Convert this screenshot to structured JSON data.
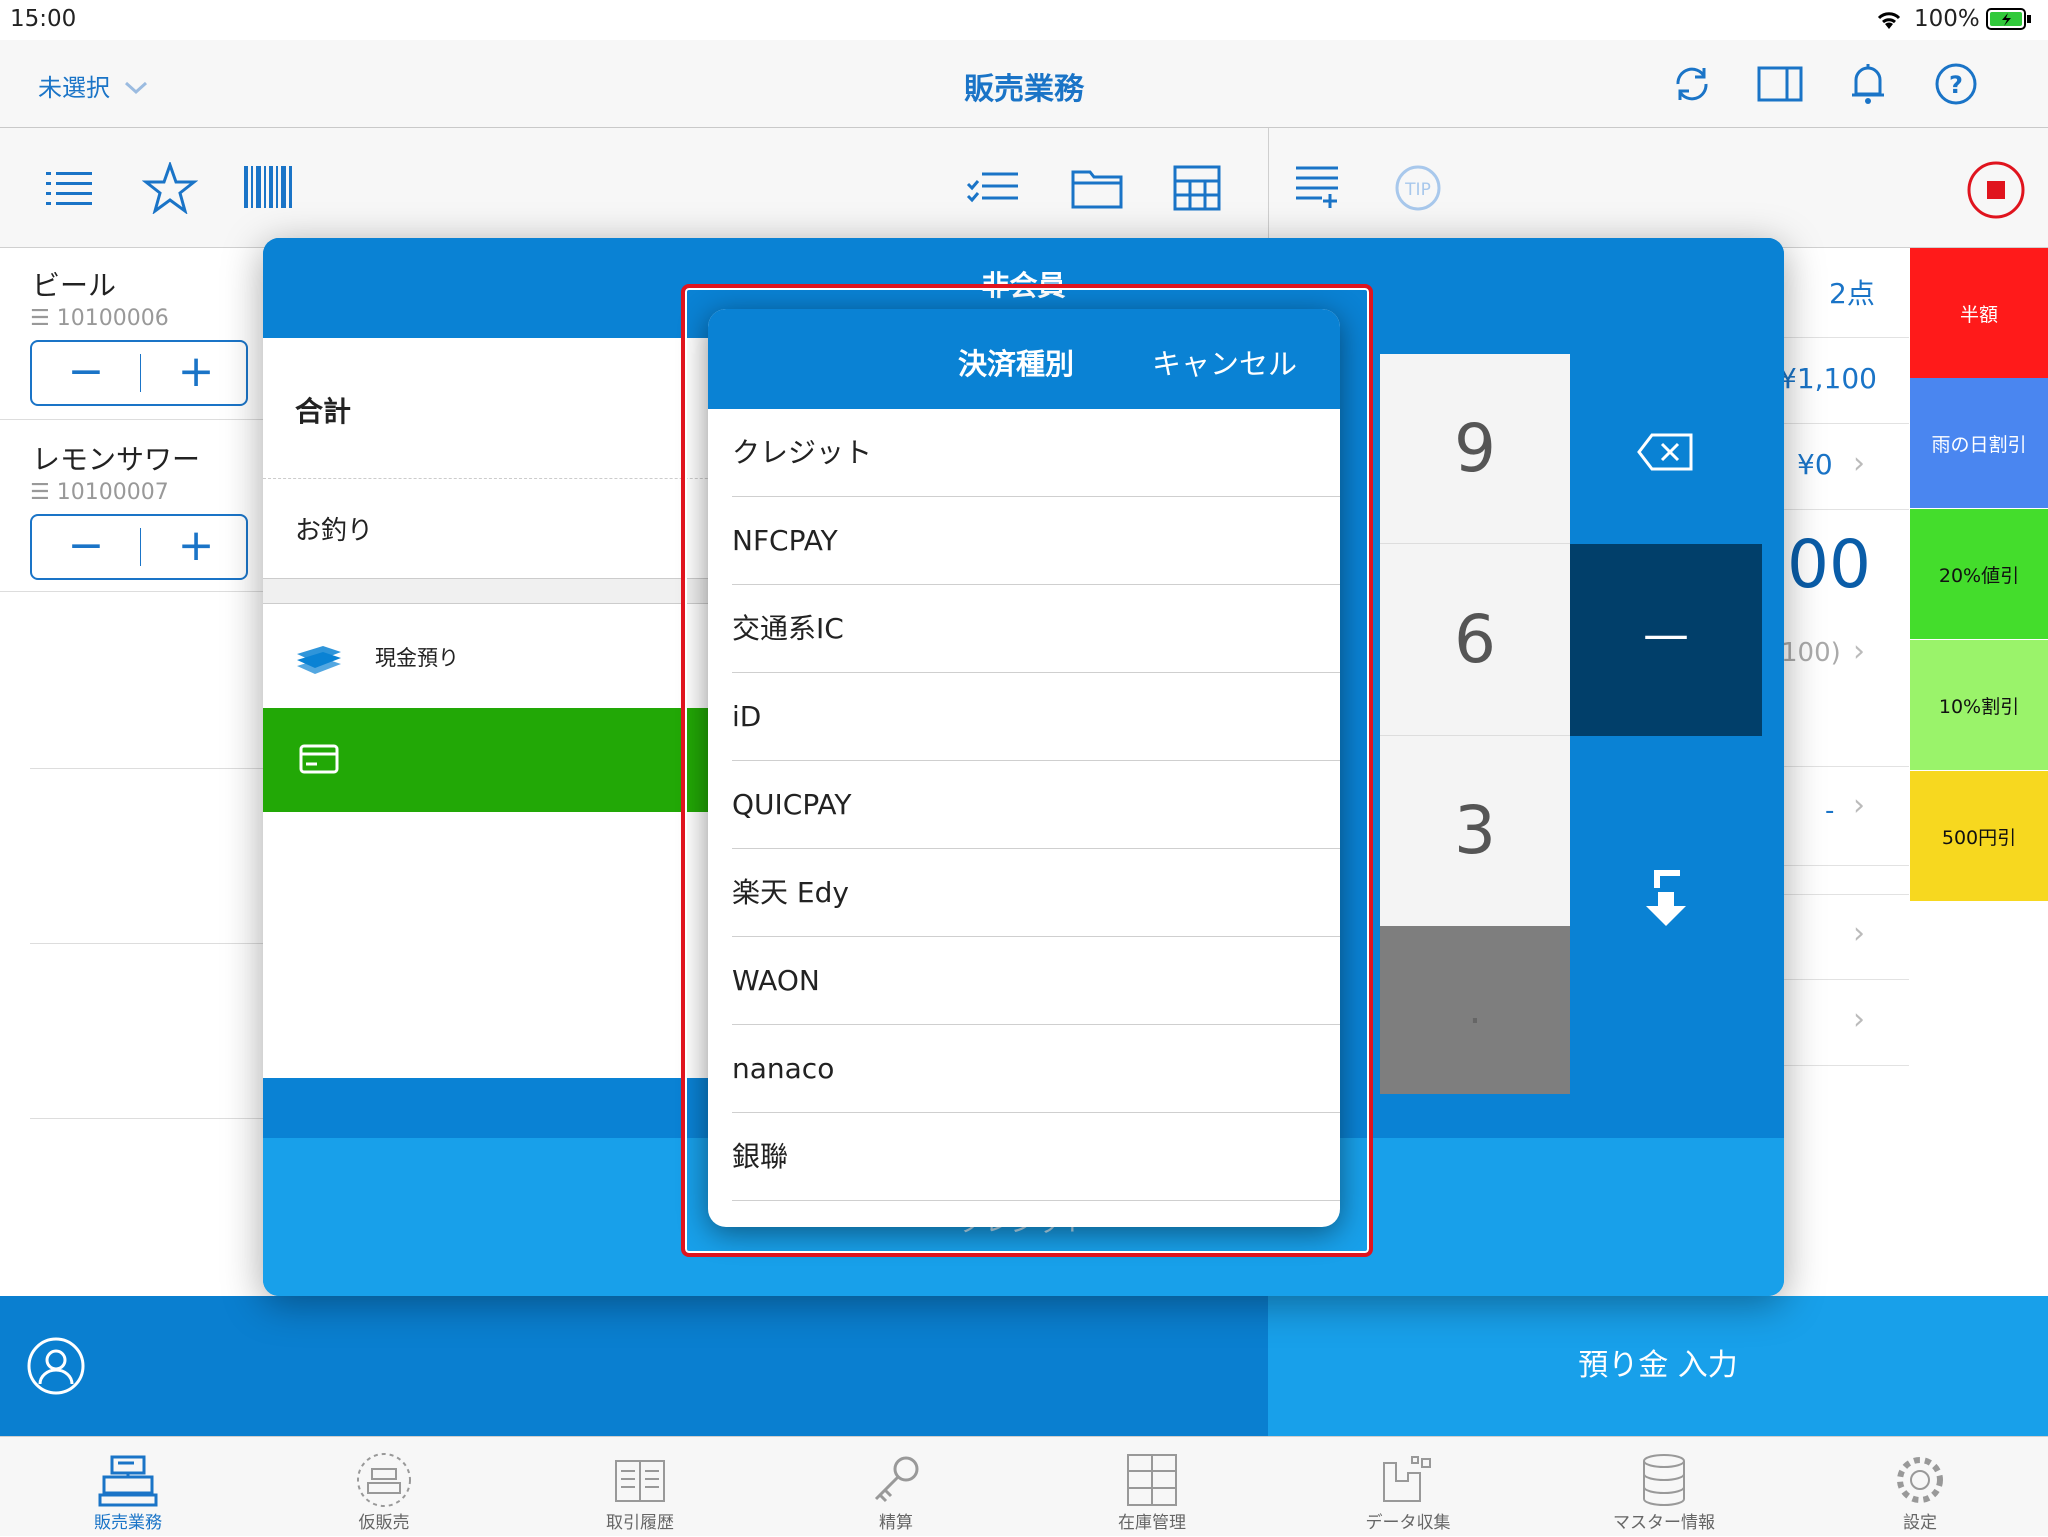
{
  "status": {
    "time": "15:00",
    "battery": "100%"
  },
  "header": {
    "store_select": "未選択",
    "title": "販売業務"
  },
  "items": [
    {
      "name": "ビール",
      "code": "10100006"
    },
    {
      "name": "レモンサワー",
      "code": "10100007"
    }
  ],
  "right_panel": {
    "count": "2点",
    "subtotal": "¥1,100",
    "discount": "¥0",
    "big_amount": "00",
    "paren": "100)",
    "dash": "-"
  },
  "side_buttons": [
    {
      "label": "半額",
      "color": "#ff1a1a"
    },
    {
      "label": "雨の日割引",
      "color": "#4a86f0"
    },
    {
      "label": "20%値引",
      "color": "#44dd2c"
    },
    {
      "label": "10%割引",
      "color": "#9af36a"
    },
    {
      "label": "500円引",
      "color": "#f7d81f"
    }
  ],
  "modal": {
    "title": "非会員",
    "total_label": "合計",
    "change_label": "お釣り",
    "cash_label": "現金預り",
    "bottom_label": "クレジット"
  },
  "keypad": {
    "k9": "9",
    "k6": "6",
    "k3": "3",
    "kdot": ".",
    "minus": "—"
  },
  "popup": {
    "title": "決済種別",
    "cancel": "キャンセル",
    "options": [
      "クレジット",
      "NFCPAY",
      "交通系IC",
      "iD",
      "QUICPAY",
      "楽天 Edy",
      "WAON",
      "nanaco",
      "銀聯"
    ]
  },
  "bottom": {
    "deposit_input": "預り金 入力"
  },
  "tabs": [
    "販売業務",
    "仮販売",
    "取引履歴",
    "精算",
    "在庫管理",
    "データ収集",
    "マスター情報",
    "設定"
  ],
  "colors": {
    "primary": "#0a82d4",
    "accent": "#1a74c7",
    "green": "#22a806",
    "highlight": "#e0141e"
  }
}
